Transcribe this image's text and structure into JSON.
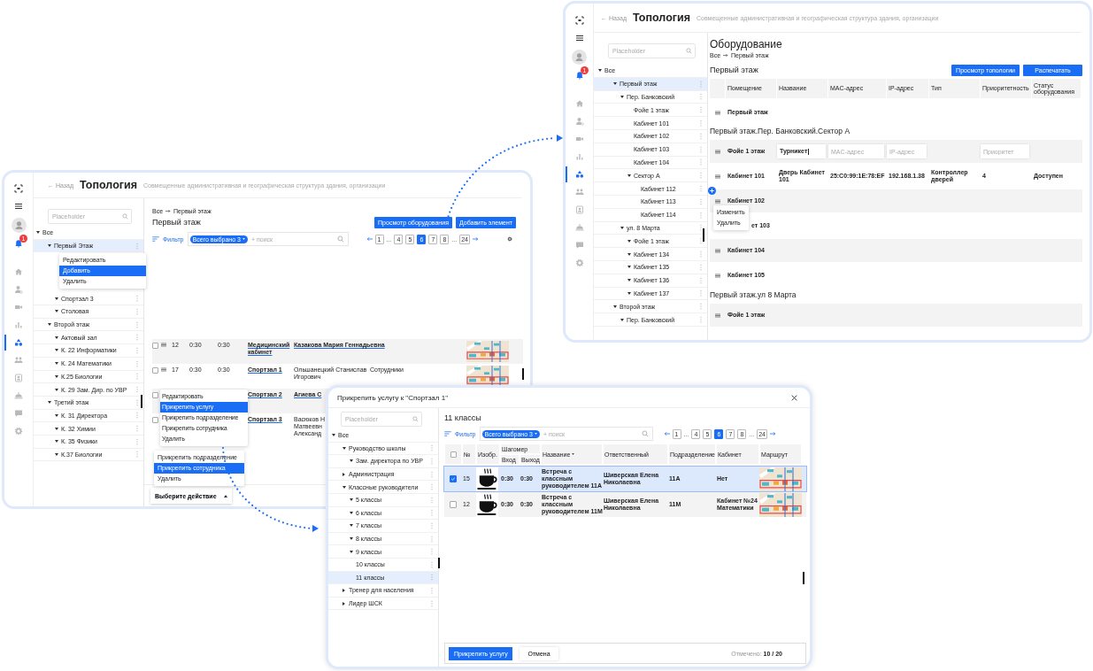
{
  "topology_window": {
    "nav": [
      {
        "kind": "scan",
        "selected": false
      },
      {
        "kind": "menu",
        "selected": false
      },
      {
        "kind": "avatar",
        "selected": false
      },
      {
        "kind": "bell",
        "selected": false,
        "badge": "1"
      },
      {
        "kind": "home",
        "selected": false
      },
      {
        "kind": "user",
        "selected": false
      },
      {
        "kind": "video",
        "selected": false
      },
      {
        "kind": "chart",
        "selected": false
      },
      {
        "kind": "topology",
        "selected": true
      },
      {
        "kind": "people",
        "selected": false
      },
      {
        "kind": "contact",
        "selected": false
      },
      {
        "kind": "dome",
        "selected": false
      },
      {
        "kind": "chat",
        "selected": false
      },
      {
        "kind": "gear",
        "selected": false
      }
    ],
    "back": "← Назад",
    "title": "Топология",
    "subtitle": "Совмещенные административная и географическая структура здания, организации",
    "tree_search": {
      "placeholder": "Placeholder"
    },
    "tree": [
      {
        "label": "Все",
        "expanded": true,
        "selected": false,
        "children": [
          {
            "label": "Первый Этаж",
            "expanded": true,
            "selected": true,
            "menu": [
              {
                "label": "Редактировать",
                "selected": false
              },
              {
                "label": "Добавить",
                "selected": true
              },
              {
                "label": "Удалить",
                "selected": false
              }
            ],
            "children": [
              {
                "label": "Спортзал 3",
                "expanded": true,
                "selected": false
              },
              {
                "label": "Столовая",
                "expanded": true,
                "selected": false
              }
            ]
          },
          {
            "label": "Второй этаж",
            "expanded": true,
            "selected": false,
            "children": [
              {
                "label": "Актовый зал",
                "expanded": true,
                "selected": false
              },
              {
                "label": "К. 22 Информатики",
                "expanded": true,
                "selected": false
              },
              {
                "label": "К. 24 Математики",
                "expanded": true,
                "selected": false
              },
              {
                "label": "К.25 Биологии",
                "expanded": true,
                "selected": false
              },
              {
                "label": "К. 29 Зам. Дир. по УВР",
                "expanded": true,
                "selected": false
              }
            ]
          },
          {
            "label": "Третий этаж",
            "expanded": true,
            "selected": false,
            "children": [
              {
                "label": "К. 31 Директора",
                "expanded": true,
                "selected": false
              },
              {
                "label": "К. 32 Химии",
                "expanded": true,
                "selected": false
              },
              {
                "label": "К. 35 Физики",
                "expanded": true,
                "selected": false
              },
              {
                "label": "К.37 Биологии",
                "expanded": true,
                "selected": false
              }
            ]
          }
        ]
      }
    ],
    "breadcrumb": [
      "Все",
      "Первый этаж"
    ],
    "heading": "Первый этаж",
    "buttons": [
      "Просмотр оборудования",
      "Добавить элемент"
    ],
    "filter": {
      "label": "Фильтр",
      "chip": "Всего выбрано 3",
      "hint": "+ поиск"
    },
    "pagination": [
      {
        "kind": "page",
        "label": "1",
        "selected": false
      },
      {
        "kind": "ellipsis",
        "label": "..."
      },
      {
        "kind": "page",
        "label": "4",
        "selected": false
      },
      {
        "kind": "page",
        "label": "5",
        "selected": false
      },
      {
        "kind": "page",
        "label": "6",
        "selected": true
      },
      {
        "kind": "page",
        "label": "7",
        "selected": false
      },
      {
        "kind": "page",
        "label": "8",
        "selected": false
      },
      {
        "kind": "ellipsis",
        "label": "..."
      },
      {
        "kind": "page",
        "label": "24",
        "selected": false
      }
    ],
    "rows": [
      {
        "checked": false,
        "handle": true,
        "number": "12",
        "time_in": "0:30",
        "time_out": "0:30",
        "room": "Медицинский кабинет",
        "person": [
          "Казакова Мария Геннадьевна"
        ],
        "person_link": true,
        "route": {
          "kind": "picture"
        }
      },
      {
        "checked": false,
        "handle": true,
        "number": "17",
        "time_in": "0:30",
        "time_out": "0:30",
        "room": "Спортзал 1",
        "person": [
          "Ольшанецкий Станислав",
          "Игорович"
        ],
        "person_link": false,
        "role": "Сотрудники",
        "route": {
          "kind": "picture"
        }
      },
      {
        "checked": false,
        "room": "Спортзал 2",
        "person": [
          "Агиева С"
        ],
        "person_link": true
      },
      {
        "checked": false,
        "room": "Спортзал 3",
        "person": [
          "Васюков Н",
          "Матвеевн",
          "Александ"
        ],
        "person_link": false
      }
    ],
    "row_menu": [
      {
        "label": "Редактировать",
        "selected": false
      },
      {
        "label": "Прикрепить услугу",
        "selected": true
      },
      {
        "label": "Прикрепить подразделение",
        "selected": false
      },
      {
        "label": "Прикрепить сотрудника",
        "selected": false
      },
      {
        "label": "Удалить",
        "selected": false
      }
    ],
    "action_select": {
      "value": "Выберите действие",
      "expanded": true,
      "options": [
        {
          "label": "Прикрепить подразделение",
          "selected": false
        },
        {
          "label": "Прикрепить сотрудника",
          "selected": true
        },
        {
          "label": "Удалить",
          "selected": false
        }
      ]
    }
  },
  "equipment_window": {
    "nav": [
      {
        "kind": "scan",
        "selected": false
      },
      {
        "kind": "menu",
        "selected": false
      },
      {
        "kind": "avatar",
        "selected": false
      },
      {
        "kind": "bell",
        "selected": false,
        "badge": "1"
      },
      {
        "kind": "home",
        "selected": false
      },
      {
        "kind": "user",
        "selected": false
      },
      {
        "kind": "video",
        "selected": false
      },
      {
        "kind": "chart",
        "selected": false
      },
      {
        "kind": "topology",
        "selected": true
      },
      {
        "kind": "people",
        "selected": false
      },
      {
        "kind": "contact",
        "selected": false
      },
      {
        "kind": "dome",
        "selected": false
      },
      {
        "kind": "chat",
        "selected": false
      },
      {
        "kind": "gear",
        "selected": false
      }
    ],
    "back": "← Назад",
    "title": "Топология",
    "subtitle": "Совмещенные административная и географическая структура здания, организации",
    "tree_search": {
      "placeholder": "Placeholder"
    },
    "tree": [
      {
        "label": "Все",
        "expanded": true,
        "selected": false,
        "children": [
          {
            "label": "Первый этаж",
            "expanded": true,
            "selected": true,
            "children": [
              {
                "label": "Пер. Банковский",
                "expanded": true,
                "selected": false,
                "children": [
                  {
                    "label": "Фойе 1 этаж",
                    "selected": false
                  },
                  {
                    "label": "Кабинет 101",
                    "selected": false
                  },
                  {
                    "label": "Кабинет 102",
                    "selected": false
                  },
                  {
                    "label": "Кабинет 103",
                    "selected": false
                  },
                  {
                    "label": "Кабинет 104",
                    "selected": false
                  },
                  {
                    "label": "Сектор А",
                    "expanded": true,
                    "selected": false,
                    "children": [
                      {
                        "label": "Кабинет 112",
                        "selected": false
                      },
                      {
                        "label": "Кабинет 113",
                        "selected": false
                      },
                      {
                        "label": "Кабинет 114",
                        "selected": false
                      }
                    ]
                  }
                ]
              },
              {
                "label": "ул. 8 Марта",
                "expanded": true,
                "selected": false,
                "children": [
                  {
                    "label": "Фойе 1 этаж",
                    "expanded": true,
                    "selected": false
                  },
                  {
                    "label": "Кабинет 134",
                    "expanded": true,
                    "selected": false
                  },
                  {
                    "label": "Кабинет 135",
                    "expanded": true,
                    "selected": false
                  },
                  {
                    "label": "Кабинет 136",
                    "expanded": true,
                    "selected": false
                  },
                  {
                    "label": "Кабинет 137",
                    "expanded": true,
                    "selected": false
                  }
                ]
              }
            ]
          },
          {
            "label": "Второй этаж",
            "expanded": true,
            "selected": false,
            "children": [
              {
                "label": "Пер. Банковский",
                "expanded": true,
                "selected": false
              }
            ]
          }
        ]
      }
    ],
    "heading": "Оборудование",
    "breadcrumb": [
      "Все",
      "Первый этаж"
    ],
    "subheading": "Первый этаж",
    "buttons": [
      "Просмотр топологии",
      "Распечатать"
    ],
    "columns": [
      "Помещение",
      "Название",
      "MAC-адрес",
      "IP-адрес",
      "Тип",
      "Приоритетность",
      "Статус оборудования"
    ],
    "top_rows": [
      {
        "kind": "row",
        "handle": true,
        "room": "Первый этаж"
      }
    ],
    "sections": [
      {
        "title": "Первый этаж.Пер. Банковский.Сектор А",
        "rows": [
          {
            "kind": "edit",
            "handle": true,
            "room": "Фойе 1 этаж",
            "name": {
              "value": "Турникет",
              "focused": true
            },
            "mac": {
              "placeholder": "MAC-адрес"
            },
            "ip": {
              "placeholder": "IP-адрес"
            },
            "priority": {
              "placeholder": "Приоритет"
            }
          },
          {
            "kind": "row",
            "handle": true,
            "room": "Кабинет 101",
            "name": "Дверь Кабинет 101",
            "mac": "25:C0:99:1E:78:EF",
            "ip": "192.168.1.38",
            "type": "Контроллер дверей",
            "priority": "4",
            "status": "Доступен"
          },
          {
            "kind": "row",
            "handle": true,
            "room": "Кабинет 102",
            "menu": [
              {
                "label": "Изменить",
                "selected": false
              },
              {
                "label": "Удалить",
                "selected": false
              }
            ]
          },
          {
            "kind": "row",
            "handle": false,
            "room": "ет 103"
          },
          {
            "kind": "row",
            "handle": true,
            "room": "Кабинет 104"
          },
          {
            "kind": "row",
            "handle": true,
            "room": "Кабинет 105"
          }
        ]
      },
      {
        "title": "Первый этаж.ул 8 Марта",
        "rows": [
          {
            "kind": "row",
            "handle": true,
            "room": "Фойе 1 этаж"
          }
        ]
      }
    ]
  },
  "attach_dialog": {
    "title": "Прикрепить услугу к \"Спортзал 1\"",
    "tree_search": {
      "placeholder": "Placeholder"
    },
    "tree": [
      {
        "label": "Все",
        "expanded": true,
        "selected": false,
        "children": [
          {
            "label": "Руководство школы",
            "expanded": true,
            "selected": false,
            "children": [
              {
                "label": "Зам. директора по УВР",
                "expanded": true,
                "selected": false
              }
            ]
          },
          {
            "label": "Администрация",
            "expanded": false,
            "selected": false
          },
          {
            "label": "Классные руководители",
            "expanded": true,
            "selected": false,
            "children": [
              {
                "label": "5 классы",
                "expanded": true,
                "selected": false
              },
              {
                "label": "6 классы",
                "expanded": true,
                "selected": false
              },
              {
                "label": "7 классы",
                "expanded": true,
                "selected": false
              },
              {
                "label": "8 классы",
                "expanded": true,
                "selected": false
              },
              {
                "label": "9 классы",
                "expanded": true,
                "selected": false
              },
              {
                "label": "10 классы",
                "selected": false
              },
              {
                "label": "11 классы",
                "selected": true
              }
            ]
          },
          {
            "label": "Тренер для населения",
            "expanded": false,
            "selected": false
          },
          {
            "label": "Лидер ШСК",
            "expanded": false,
            "selected": false
          }
        ]
      }
    ],
    "heading": "11 классы",
    "filter": {
      "label": "Фильтр",
      "chip": "Всего выбрано 3",
      "hint": "+ поиск"
    },
    "pagination": [
      {
        "kind": "page",
        "label": "1",
        "selected": false
      },
      {
        "kind": "ellipsis",
        "label": "..."
      },
      {
        "kind": "page",
        "label": "4",
        "selected": false
      },
      {
        "kind": "page",
        "label": "5",
        "selected": false
      },
      {
        "kind": "page",
        "label": "6",
        "selected": true
      },
      {
        "kind": "page",
        "label": "7",
        "selected": false
      },
      {
        "kind": "page",
        "label": "8",
        "selected": false
      },
      {
        "kind": "ellipsis",
        "label": "..."
      },
      {
        "kind": "page",
        "label": "24",
        "selected": false
      }
    ],
    "header_checkbox": {
      "checked": false
    },
    "columns": {
      "number": "№",
      "image": "Изобр.",
      "pedometer": "Шагомер",
      "time_in": "Вход",
      "time_out": "Выход",
      "title": "Название",
      "responsible": "Ответственный",
      "unit": "Подразделение",
      "room": "Кабинет",
      "route": "Маршрут"
    },
    "rows": [
      {
        "selected": true,
        "checked": true,
        "number": "15",
        "time_in": "0:30",
        "time_out": "0:30",
        "title": "Встреча с классным руководителем 11А",
        "responsible": "Шиверская Елена Николаевна",
        "unit": "11А",
        "room": "Нет"
      },
      {
        "selected": false,
        "checked": false,
        "number": "12",
        "time_in": "0:30",
        "time_out": "0:30",
        "title": "Встреча с классным руководителем 11М",
        "responsible": "Шиверская Елена Николаевна",
        "unit": "11М",
        "room": "Кабинет №24 Математики"
      }
    ],
    "primary_button": "Прикрепить услугу",
    "secondary_button": "Отмена",
    "status": "Отмечено: **10 / 20**"
  }
}
